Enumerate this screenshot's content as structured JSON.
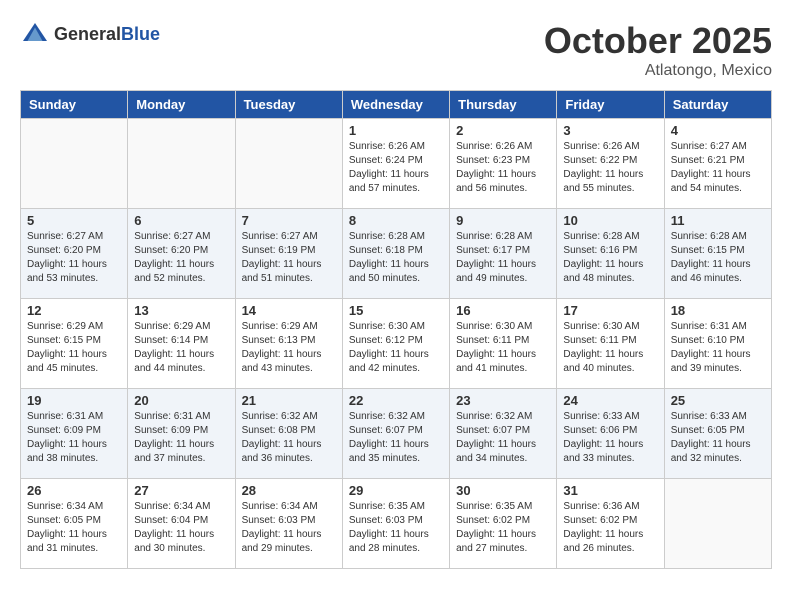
{
  "header": {
    "logo": {
      "general": "General",
      "blue": "Blue"
    },
    "month": "October 2025",
    "location": "Atlatongo, Mexico"
  },
  "weekdays": [
    "Sunday",
    "Monday",
    "Tuesday",
    "Wednesday",
    "Thursday",
    "Friday",
    "Saturday"
  ],
  "weeks": [
    [
      {
        "day": "",
        "info": ""
      },
      {
        "day": "",
        "info": ""
      },
      {
        "day": "",
        "info": ""
      },
      {
        "day": "1",
        "info": "Sunrise: 6:26 AM\nSunset: 6:24 PM\nDaylight: 11 hours and 57 minutes."
      },
      {
        "day": "2",
        "info": "Sunrise: 6:26 AM\nSunset: 6:23 PM\nDaylight: 11 hours and 56 minutes."
      },
      {
        "day": "3",
        "info": "Sunrise: 6:26 AM\nSunset: 6:22 PM\nDaylight: 11 hours and 55 minutes."
      },
      {
        "day": "4",
        "info": "Sunrise: 6:27 AM\nSunset: 6:21 PM\nDaylight: 11 hours and 54 minutes."
      }
    ],
    [
      {
        "day": "5",
        "info": "Sunrise: 6:27 AM\nSunset: 6:20 PM\nDaylight: 11 hours and 53 minutes."
      },
      {
        "day": "6",
        "info": "Sunrise: 6:27 AM\nSunset: 6:20 PM\nDaylight: 11 hours and 52 minutes."
      },
      {
        "day": "7",
        "info": "Sunrise: 6:27 AM\nSunset: 6:19 PM\nDaylight: 11 hours and 51 minutes."
      },
      {
        "day": "8",
        "info": "Sunrise: 6:28 AM\nSunset: 6:18 PM\nDaylight: 11 hours and 50 minutes."
      },
      {
        "day": "9",
        "info": "Sunrise: 6:28 AM\nSunset: 6:17 PM\nDaylight: 11 hours and 49 minutes."
      },
      {
        "day": "10",
        "info": "Sunrise: 6:28 AM\nSunset: 6:16 PM\nDaylight: 11 hours and 48 minutes."
      },
      {
        "day": "11",
        "info": "Sunrise: 6:28 AM\nSunset: 6:15 PM\nDaylight: 11 hours and 46 minutes."
      }
    ],
    [
      {
        "day": "12",
        "info": "Sunrise: 6:29 AM\nSunset: 6:15 PM\nDaylight: 11 hours and 45 minutes."
      },
      {
        "day": "13",
        "info": "Sunrise: 6:29 AM\nSunset: 6:14 PM\nDaylight: 11 hours and 44 minutes."
      },
      {
        "day": "14",
        "info": "Sunrise: 6:29 AM\nSunset: 6:13 PM\nDaylight: 11 hours and 43 minutes."
      },
      {
        "day": "15",
        "info": "Sunrise: 6:30 AM\nSunset: 6:12 PM\nDaylight: 11 hours and 42 minutes."
      },
      {
        "day": "16",
        "info": "Sunrise: 6:30 AM\nSunset: 6:11 PM\nDaylight: 11 hours and 41 minutes."
      },
      {
        "day": "17",
        "info": "Sunrise: 6:30 AM\nSunset: 6:11 PM\nDaylight: 11 hours and 40 minutes."
      },
      {
        "day": "18",
        "info": "Sunrise: 6:31 AM\nSunset: 6:10 PM\nDaylight: 11 hours and 39 minutes."
      }
    ],
    [
      {
        "day": "19",
        "info": "Sunrise: 6:31 AM\nSunset: 6:09 PM\nDaylight: 11 hours and 38 minutes."
      },
      {
        "day": "20",
        "info": "Sunrise: 6:31 AM\nSunset: 6:09 PM\nDaylight: 11 hours and 37 minutes."
      },
      {
        "day": "21",
        "info": "Sunrise: 6:32 AM\nSunset: 6:08 PM\nDaylight: 11 hours and 36 minutes."
      },
      {
        "day": "22",
        "info": "Sunrise: 6:32 AM\nSunset: 6:07 PM\nDaylight: 11 hours and 35 minutes."
      },
      {
        "day": "23",
        "info": "Sunrise: 6:32 AM\nSunset: 6:07 PM\nDaylight: 11 hours and 34 minutes."
      },
      {
        "day": "24",
        "info": "Sunrise: 6:33 AM\nSunset: 6:06 PM\nDaylight: 11 hours and 33 minutes."
      },
      {
        "day": "25",
        "info": "Sunrise: 6:33 AM\nSunset: 6:05 PM\nDaylight: 11 hours and 32 minutes."
      }
    ],
    [
      {
        "day": "26",
        "info": "Sunrise: 6:34 AM\nSunset: 6:05 PM\nDaylight: 11 hours and 31 minutes."
      },
      {
        "day": "27",
        "info": "Sunrise: 6:34 AM\nSunset: 6:04 PM\nDaylight: 11 hours and 30 minutes."
      },
      {
        "day": "28",
        "info": "Sunrise: 6:34 AM\nSunset: 6:03 PM\nDaylight: 11 hours and 29 minutes."
      },
      {
        "day": "29",
        "info": "Sunrise: 6:35 AM\nSunset: 6:03 PM\nDaylight: 11 hours and 28 minutes."
      },
      {
        "day": "30",
        "info": "Sunrise: 6:35 AM\nSunset: 6:02 PM\nDaylight: 11 hours and 27 minutes."
      },
      {
        "day": "31",
        "info": "Sunrise: 6:36 AM\nSunset: 6:02 PM\nDaylight: 11 hours and 26 minutes."
      },
      {
        "day": "",
        "info": ""
      }
    ]
  ]
}
